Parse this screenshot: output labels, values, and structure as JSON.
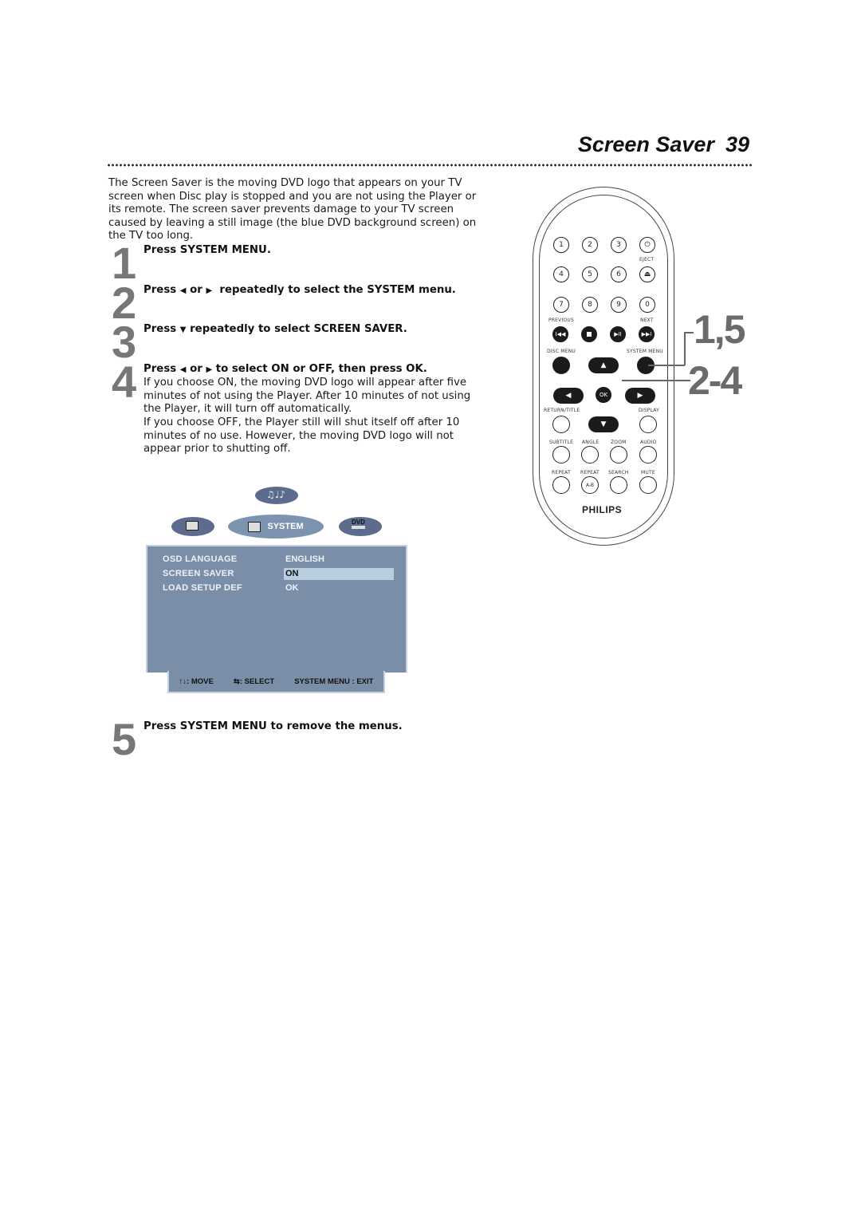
{
  "header": {
    "title": "Screen Saver",
    "page_number": "39"
  },
  "intro": "The Screen Saver is the moving DVD logo that appears on your TV screen when Disc play is stopped and you are not using the Player or its remote. The screen saver prevents damage to your TV screen caused by leaving a still image (the blue DVD background screen) on the TV too long.",
  "steps": [
    {
      "number": "1",
      "pre": "Press ",
      "bold": "SYSTEM MENU.",
      "post": ""
    },
    {
      "number": "2",
      "pre": "Press ",
      "left_arrow": "◀",
      "or": " or ",
      "right_arrow": "▶",
      "post_a": "  repeatedly to select the ",
      "bold": "SYSTEM",
      "post": " menu."
    },
    {
      "number": "3",
      "pre": "Press ",
      "down_arrow": "▼",
      "post": " repeatedly to select SCREEN SAVER."
    },
    {
      "number": "4",
      "pre": "Press ",
      "left_arrow": "◀",
      "or": " or ",
      "right_arrow": "▶",
      "post": " to select ON or OFF, then press OK.",
      "body_1": "If you choose ON, the moving DVD logo will appear after five minutes of not using the Player.  After 10 minutes of not using the Player, it will turn off automatically.",
      "body_2": "If you choose OFF, the Player still will shut itself off after 10 minutes of no use. However, the moving DVD logo will not appear prior to shutting off."
    },
    {
      "number": "5",
      "pre": "Press ",
      "bold": "SYSTEM MENU",
      "post": " to remove the menus."
    }
  ],
  "osd": {
    "tabs": {
      "system_label": "SYSTEM",
      "dvd_label": "DVD"
    },
    "rows": [
      {
        "label": "OSD LANGUAGE",
        "value": "ENGLISH"
      },
      {
        "label": "SCREEN SAVER",
        "value": "ON",
        "selected": true
      },
      {
        "label": "LOAD SETUP DEF",
        "value": "OK"
      }
    ],
    "footer": {
      "move": ": MOVE",
      "select": ": SELECT",
      "exit": "SYSTEM MENU : EXIT"
    }
  },
  "remote": {
    "row1": [
      "1",
      "2",
      "3"
    ],
    "eject_label": "EJECT",
    "row2": [
      "4",
      "5",
      "6"
    ],
    "row3": [
      "7",
      "8",
      "9",
      "0"
    ],
    "previous_label": "PREVIOUS",
    "next_label": "NEXT",
    "disc_menu_label": "DISC MENU",
    "system_menu_label": "SYSTEM MENU",
    "ok_label": "OK",
    "return_title_label": "RETURN/TITLE",
    "display_label": "DISPLAY",
    "row_labels_a": [
      "SUBTITLE",
      "ANGLE",
      "ZOOM",
      "AUDIO"
    ],
    "row_labels_b": [
      "REPEAT",
      "REPEAT",
      "SEARCH",
      "MUTE"
    ],
    "ab_label": "A-B",
    "brand": "PHILIPS"
  },
  "callouts": {
    "first": "1,5",
    "second": "2-4"
  }
}
